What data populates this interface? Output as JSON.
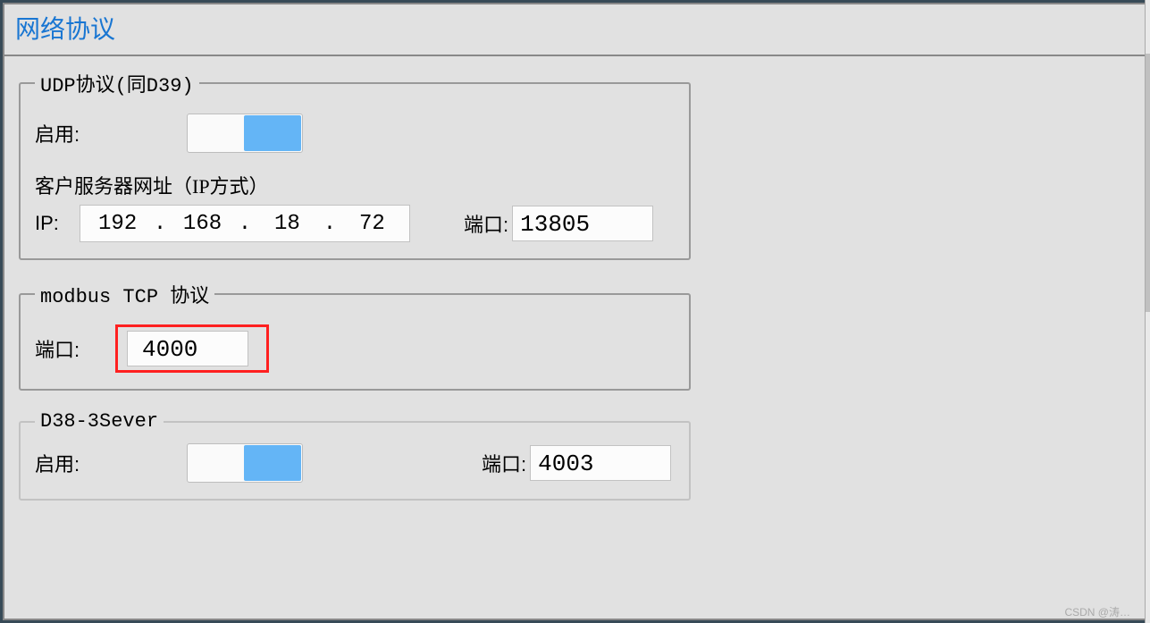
{
  "page": {
    "title": "网络协议"
  },
  "udp": {
    "legend": "UDP协议(同D39)",
    "enable_label": "启用:",
    "enabled": true,
    "ip_header": "客户服务器网址（IP方式）",
    "ip_label": "IP:",
    "ip_segments": [
      "192",
      "168",
      "18",
      "72"
    ],
    "port_label": "端口:",
    "port_value": "13805"
  },
  "modbus": {
    "legend": "modbus TCP 协议",
    "port_label": "端口:",
    "port_value": "4000"
  },
  "d38": {
    "legend": "D38-3Sever",
    "enable_label": "启用:",
    "enabled": true,
    "port_label": "端口:",
    "port_value": "4003"
  },
  "watermark": "CSDN @涛…"
}
